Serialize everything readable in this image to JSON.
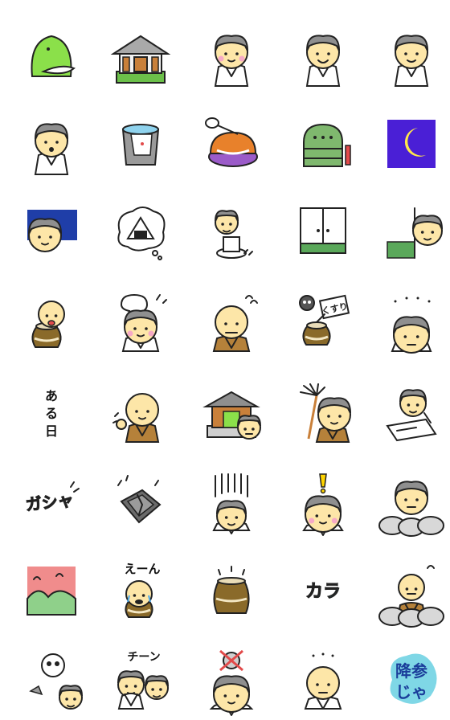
{
  "sticker_sheet": {
    "columns": 5,
    "rows": 8,
    "texts": {
      "aruhi": "ある日",
      "gasha": "ガシャ",
      "kusuri": "くすり",
      "een": "えーん",
      "kara": "カラ",
      "chiin": "チーン",
      "kousan": "降参",
      "ja": "じゃ"
    },
    "stickers": [
      {
        "icon": "green-creature"
      },
      {
        "icon": "temple-building"
      },
      {
        "icon": "monk-blushing"
      },
      {
        "icon": "monk-smiling"
      },
      {
        "icon": "monk-smiling-2"
      },
      {
        "icon": "monk-surprised"
      },
      {
        "icon": "bucket"
      },
      {
        "icon": "bowl-with-mallet"
      },
      {
        "icon": "temple-bell"
      },
      {
        "icon": "crescent-moon-night"
      },
      {
        "icon": "monk-in-bed"
      },
      {
        "icon": "rice-ball-thought"
      },
      {
        "icon": "monk-sitting"
      },
      {
        "icon": "sliding-doors"
      },
      {
        "icon": "monk-peeking"
      },
      {
        "icon": "monk-eating-from-jar"
      },
      {
        "icon": "monk-thinking"
      },
      {
        "icon": "old-monk-angry"
      },
      {
        "icon": "poison-medicine-jar"
      },
      {
        "icon": "monk-silent"
      },
      {
        "icon": "aruhi-text"
      },
      {
        "icon": "monk-waving"
      },
      {
        "icon": "temple-gate"
      },
      {
        "icon": "monk-with-duster"
      },
      {
        "icon": "monk-writing"
      },
      {
        "icon": "gasha-text"
      },
      {
        "icon": "broken-plate"
      },
      {
        "icon": "monk-shocked-lines"
      },
      {
        "icon": "monk-exclamation"
      },
      {
        "icon": "monk-behind-rocks"
      },
      {
        "icon": "sunset-mountains"
      },
      {
        "icon": "monk-crying"
      },
      {
        "icon": "clay-jar"
      },
      {
        "icon": "kara-text"
      },
      {
        "icon": "old-monk-behind-rocks"
      },
      {
        "icon": "skull-broken"
      },
      {
        "icon": "monks-chiin"
      },
      {
        "icon": "no-skull-monk"
      },
      {
        "icon": "monk-dots"
      },
      {
        "icon": "kousan-ja-text"
      }
    ]
  }
}
